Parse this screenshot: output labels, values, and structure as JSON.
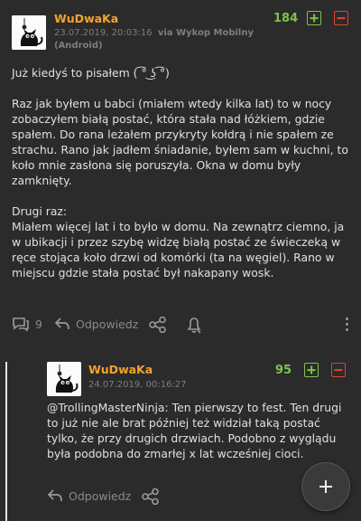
{
  "entry": {
    "author": "WuDwaKa",
    "meta_line1": "23.07.2019, 20:03:16",
    "via": "via Wykop Mobilny",
    "meta_line2": "(Android)",
    "score": "184",
    "body": "Już kiedyś to pisałem ( ͡° ͜ʖ ͡°)\n\nRaz jak byłem u babci (miałem wtedy kilka lat) to w nocy zobaczyłem białą postać, która stała nad łóżkiem, gdzie spałem. Do rana leżałem przykryty kołdrą i nie spałem ze strachu. Rano jak jadłem śniadanie, byłem sam w kuchni, to koło mnie zasłona się poruszyła. Okna w domu były zamknięty.\n\nDrugi raz:\nMiałem więcej lat i to było w domu. Na zewnątrz ciemno, ja w ubikacji i przez szybę widzę białą postać ze świeczeką w ręce stojąca koło drzwi od komórki (ta na węgiel). Rano w miejscu gdzie stała postać był nakapany wosk.",
    "comments_count": "9",
    "reply_label": "Odpowiedz"
  },
  "reply": {
    "author": "WuDwaKa",
    "meta": "24.07.2019, 00:16:27",
    "score": "95",
    "body": "@TrollingMasterNinja: Ten pierwszy to fest. Ten drugi to już nie ale brat później też widział taką postać tylko, że przy drugich drzwiach. Podobno z wyglądu była podobna do zmarłej x lat wcześniej cioci.",
    "reply_label": "Odpowiedz"
  },
  "colors": {
    "author": "#f2a32c",
    "plus": "#7fc14d",
    "minus": "#e0452c",
    "background": "#2b2b2b"
  }
}
